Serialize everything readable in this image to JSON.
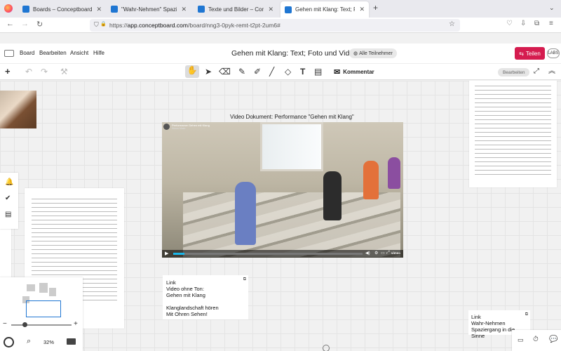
{
  "browser": {
    "tabs": [
      {
        "title": "Boards – Conceptboard",
        "active": false
      },
      {
        "title": "\"Wahr-Nehmen\" Spaziergang in",
        "active": false
      },
      {
        "title": "Texte und Bilder – Conceptbo",
        "active": false
      },
      {
        "title": "Gehen mit Klang: Text; Foto und",
        "active": true
      }
    ],
    "new_tab": "+",
    "url_host": "app.conceptboard.com",
    "url_prefix": "https://",
    "url_path": "/board/nng3-0pyk-remt-t2pt-2um6#"
  },
  "app": {
    "menu": [
      "Board",
      "Bearbeiten",
      "Ansicht",
      "Hilfe"
    ],
    "title": "Gehen mit Klang: Text; Foto und Video",
    "participants": "Alle Teilnehmer",
    "share_label": "Teilen",
    "labs_label": "LABS"
  },
  "toolbar": {
    "comment_label": "Kommentar",
    "mode_label": "Bearbeiten"
  },
  "canvas": {
    "video_caption": "Video Dokument: Performance \"Gehen mit Klang\"",
    "video": {
      "title": "Performance Gehen mit Klang",
      "channel": "Simon Maier",
      "brand": "vimeo"
    },
    "link_card_1": {
      "lines": [
        "Link",
        "Video ohne Ton:",
        "Gehen mit Klang",
        "",
        "Klanglandschaft hören",
        "Mit Ohren Sehen!"
      ]
    },
    "link_card_2": {
      "lines": [
        "Link",
        "Wahr-Nehmen",
        "Spaziergang in die Sinne"
      ]
    }
  },
  "zoom": {
    "level": "32%",
    "minus": "−",
    "plus": "+"
  },
  "colors": {
    "accent": "#d51c4f",
    "tab_favicon": "#1f76d2",
    "video_progress": "#1ab7ea"
  }
}
